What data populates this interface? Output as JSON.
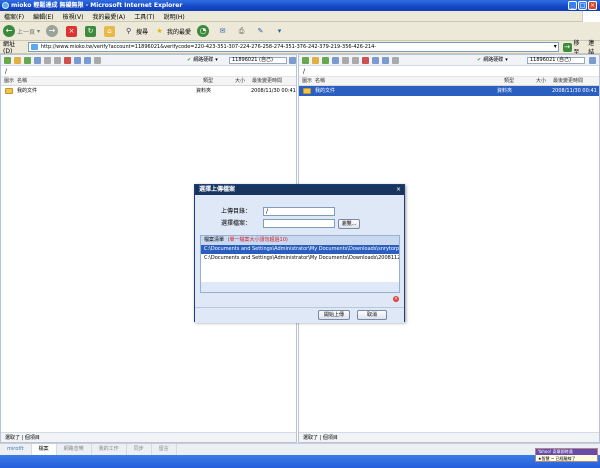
{
  "window": {
    "title": "mioko 輕鬆達成 無礙無限 - Microsoft Internet Explorer"
  },
  "menu": [
    "檔案(F)",
    "編輯(E)",
    "檢視(V)",
    "我的最愛(A)",
    "工具(T)",
    "說明(H)"
  ],
  "toolbar": {
    "back": "上一頁",
    "search": "搜尋",
    "favorites": "我的最愛"
  },
  "address": {
    "label": "網址(D)",
    "url": "http://www.mioko.tw/verify?account=11896021&verifycode=220-423-351-307-224-276-258-274-351-376-242-379-219-356-426-214-",
    "go": "移至",
    "links": "連結"
  },
  "left_pane": {
    "connection": "網路硬碟",
    "account": "11896021 (自己)",
    "path": "/",
    "columns": [
      "圖示",
      "名稱",
      "類型",
      "大小",
      "最後變更時間"
    ],
    "rows": [
      {
        "name": "我的文件",
        "type": "資料夾",
        "size": "",
        "modified": "2008/11/30 00:41"
      }
    ],
    "footer": "選取了 | 個項目"
  },
  "right_pane": {
    "connection": "網路硬碟",
    "account": "11896021 (自己)",
    "path": "/",
    "columns": [
      "圖示",
      "名稱",
      "類型",
      "大小",
      "最後變更時間"
    ],
    "rows": [
      {
        "name": "我的文件",
        "type": "資料夾",
        "size": "",
        "modified": "2008/11/30 00:41"
      }
    ],
    "footer": "選取了 | 個項目"
  },
  "status_tabs": [
    "mirofit",
    "檔案",
    "網路音樂",
    "我的工作",
    "同步",
    "留言"
  ],
  "notify": {
    "title": "Yahoo! 奇摩即時通",
    "text": "★智慧 ~ 已經離線了"
  },
  "dialog": {
    "title": "選擇上傳檔案",
    "close": "×",
    "upload_dir_label": "上傳目錄：",
    "upload_dir_value": "/",
    "file_label": "選擇檔案：",
    "file_value": "",
    "browse": "瀏覽...",
    "list_header": "檔案清單",
    "list_note": "(單一檔案大小請勿超過10)",
    "files": [
      "C:\\Documents and Settings\\Administrator\\My Documents\\Downloads\\snrytorp2p101.t...",
      "C:\\Documents and Settings\\Administrator\\My Documents\\Downloads\\20081128_197..."
    ],
    "start": "開始上傳",
    "cancel": "取消"
  },
  "colors": {
    "title_blue": "#1548c7",
    "dialog_title": "#17355f",
    "selected_row": "#2a5fc0",
    "note_red": "#d2232a"
  }
}
